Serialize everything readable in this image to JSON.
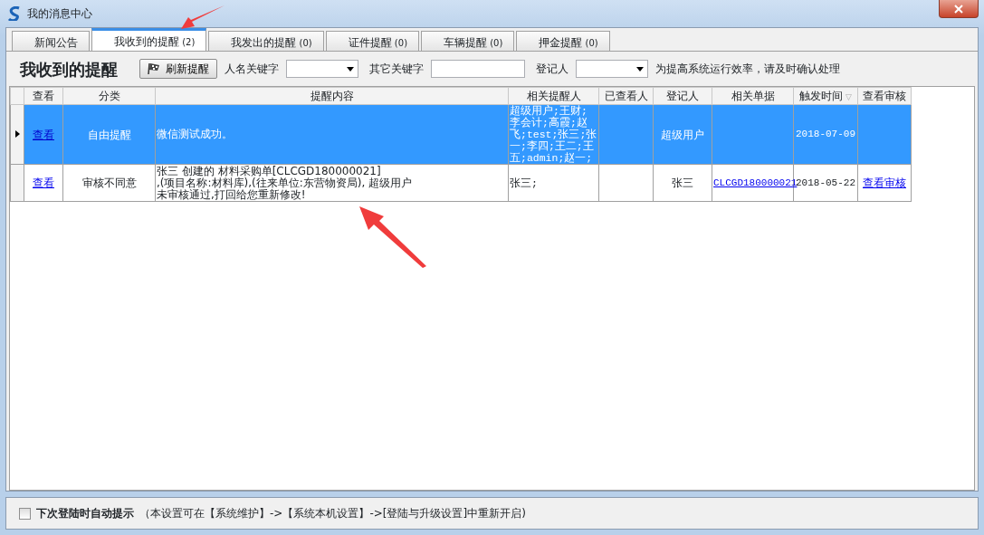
{
  "window": {
    "title": "我的消息中心"
  },
  "tabs": [
    {
      "label": "新闻公告",
      "selected": false
    },
    {
      "label": "我收到的提醒",
      "count": "(2)",
      "selected": true
    },
    {
      "label": "我发出的提醒",
      "count": "(0)",
      "selected": false
    },
    {
      "label": "证件提醒",
      "count": "(0)",
      "selected": false
    },
    {
      "label": "车辆提醒",
      "count": "(0)",
      "selected": false
    },
    {
      "label": "押金提醒",
      "count": "(0)",
      "selected": false
    }
  ],
  "toolbar": {
    "heading": "我收到的提醒",
    "refresh_button": "刷新提醒",
    "name_keyword_label": "人名关键字",
    "other_keyword_label": "其它关键字",
    "registrar_label": "登记人",
    "hint": "为提高系统运行效率，请及时确认处理"
  },
  "table": {
    "columns": [
      "查看",
      "分类",
      "提醒内容",
      "相关提醒人",
      "已查看人",
      "登记人",
      "相关单据",
      "触发时间",
      "查看审核"
    ],
    "sorted_column_marker": "▽",
    "rows": [
      {
        "selected": true,
        "view": "查看",
        "category": "自由提醒",
        "content": [
          "微信测试成功。"
        ],
        "related_people": "超级用户;王财;李会计;高霞;赵飞;test;张三;张一;李四;王二;王五;admin;赵一;",
        "viewed_by": "",
        "registrar": "超级用户",
        "document": "",
        "time": "2018-07-09",
        "review": ""
      },
      {
        "selected": false,
        "view": "查看",
        "category": "审核不同意",
        "content": [
          "张三 创建的 材料采购单[CLCGD180000021]",
          ",(项目名称:材料库),(往来单位:东营物资局), 超级用户",
          "未审核通过,打回给您重新修改!"
        ],
        "related_people": "张三;",
        "viewed_by": "",
        "registrar": "张三",
        "document": "CLCGD180000021",
        "time": "2018-05-22",
        "review": "查看审核"
      }
    ]
  },
  "footer": {
    "checkbox_label": "下次登陆时自动提示",
    "checked": false,
    "note": "（本设置可在【系统维护】->【系统本机设置】->[登陆与升级设置]中重新开启)"
  }
}
